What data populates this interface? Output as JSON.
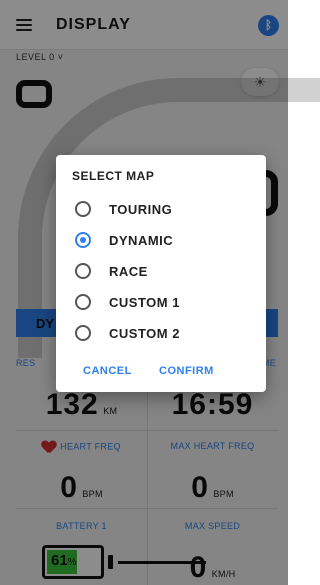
{
  "header": {
    "title": "DISPLAY",
    "menu_icon": "hamburger-menu-icon",
    "bluetooth_icon": "bluetooth-icon",
    "bluetooth_glyph": "ᛒ"
  },
  "level": {
    "label": "LEVEL 0 ˅"
  },
  "brightness_icon": "sun-icon",
  "brightness_glyph": "☀",
  "mode_bar": {
    "label": "DY"
  },
  "stats": {
    "row1_left": {
      "label": "RES",
      "value": "132",
      "unit": "KM"
    },
    "row1_right": {
      "label": "ME",
      "value": "16:59",
      "unit": ""
    },
    "row2_left": {
      "label": "HEART FREQ",
      "value": "0",
      "unit": "BPM"
    },
    "row2_right": {
      "label": "MAX HEART FREQ",
      "value": "0",
      "unit": "BPM"
    },
    "row3_left": {
      "label": "BATTERY 1",
      "value": "61",
      "unit": "%"
    },
    "row3_right": {
      "label": "MAX SPEED",
      "value": "0",
      "unit": "KM/H"
    }
  },
  "battery_level": 0.61,
  "dialog": {
    "title": "SELECT MAP",
    "options": [
      {
        "label": "TOURING",
        "selected": false
      },
      {
        "label": "DYNAMIC",
        "selected": true
      },
      {
        "label": "RACE",
        "selected": false
      },
      {
        "label": "CUSTOM 1",
        "selected": false
      },
      {
        "label": "CUSTOM 2",
        "selected": false
      }
    ],
    "cancel_label": "CANCEL",
    "confirm_label": "CONFIRM"
  },
  "colors": {
    "accent": "#2f80ed",
    "heart": "#d32f2f",
    "battery_fill": "#3cc23c"
  }
}
